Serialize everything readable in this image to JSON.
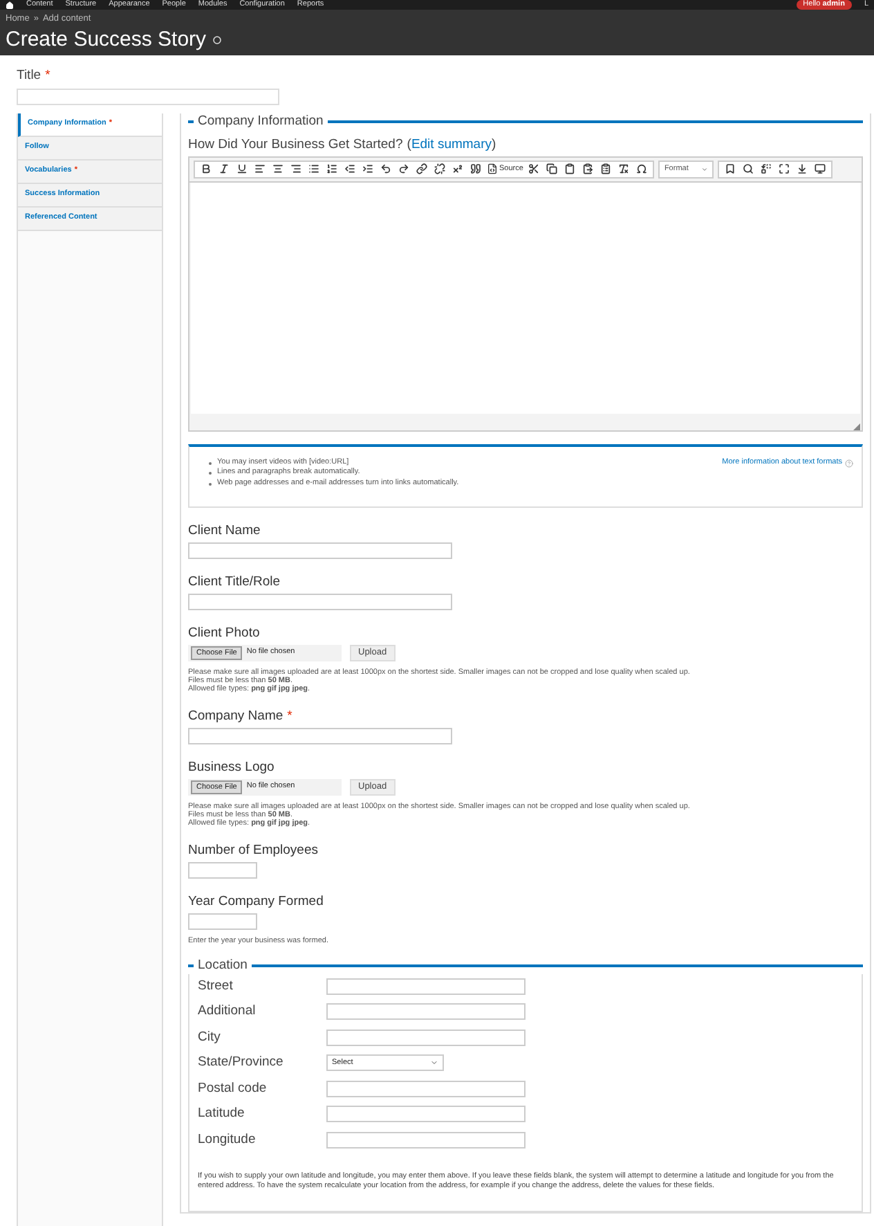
{
  "admin_bar": {
    "items": [
      "Content",
      "Structure",
      "Appearance",
      "People",
      "Modules",
      "Configuration",
      "Reports"
    ],
    "greeting": "Hello **admin**",
    "cut_item": "L"
  },
  "breadcrumb": {
    "items": [
      "Home",
      "Add content"
    ],
    "separator": "»"
  },
  "page_title": "Create Success Story",
  "required_mark": "*",
  "title_field": {
    "label": "Title",
    "required": true
  },
  "vertical_tabs": [
    {
      "label": "Company Information",
      "required": true,
      "selected": true
    },
    {
      "label": "Follow",
      "required": false,
      "selected": false
    },
    {
      "label": "Vocabularies",
      "required": true,
      "selected": false
    },
    {
      "label": "Success Information",
      "required": false,
      "selected": false
    },
    {
      "label": "Referenced Content",
      "required": false,
      "selected": false
    }
  ],
  "section": {
    "legend": "Company Information"
  },
  "editor": {
    "label": "How Did Your Business Get Started?",
    "open_paren": "(",
    "link": "Edit summary",
    "close_paren": ")",
    "source_label": "Source",
    "format_label": "Format"
  },
  "format_tips": {
    "items": [
      "You may insert videos with [video:URL]",
      "Lines and paragraphs break automatically.",
      "Web page addresses and e-mail addresses turn into links automatically."
    ],
    "more_link": "More information about text formats"
  },
  "fields": [
    {
      "kind": "text",
      "label": "Client Name",
      "required": false
    },
    {
      "kind": "text",
      "label": "Client Title/Role",
      "required": false
    },
    {
      "kind": "file",
      "label": "Client Photo",
      "required": false,
      "choose": "Choose File",
      "status": "No file chosen",
      "upload": "Upload",
      "help": [
        "Please make sure all images uploaded are at least 1000px on the shortest side. Smaller images can not be cropped and lose quality when scaled up.",
        "Files must be less than **50 MB**.",
        "Allowed file types: **png gif jpg jpeg**."
      ]
    },
    {
      "kind": "text",
      "label": "Company Name",
      "required": true
    },
    {
      "kind": "file",
      "label": "Business Logo",
      "required": false,
      "choose": "Choose File",
      "status": "No file chosen",
      "upload": "Upload",
      "help": [
        "Please make sure all images uploaded are at least 1000px on the shortest side. Smaller images can not be cropped and lose quality when scaled up.",
        "Files must be less than **50 MB**.",
        "Allowed file types: **png gif jpg jpeg**."
      ]
    },
    {
      "kind": "short",
      "label": "Number of Employees",
      "required": false
    },
    {
      "kind": "short",
      "label": "Year Company Formed",
      "required": false,
      "help": [
        "Enter the year your business was formed."
      ]
    }
  ],
  "location": {
    "legend": "Location",
    "rows": [
      {
        "kind": "text",
        "label": "Street"
      },
      {
        "kind": "text",
        "label": "Additional"
      },
      {
        "kind": "text",
        "label": "City"
      },
      {
        "kind": "select",
        "label": "State/Province",
        "value": "Select"
      },
      {
        "kind": "text",
        "label": "Postal code"
      },
      {
        "kind": "text",
        "label": "Latitude"
      },
      {
        "kind": "text",
        "label": "Longitude"
      }
    ],
    "note": "If you wish to supply your own latitude and longitude, you may enter them above. If you leave these fields blank, the system will attempt to determine a latitude and longitude for you from the entered address. To have the system recalculate your location from the address, for example if you change the address, delete the values for these fields."
  }
}
